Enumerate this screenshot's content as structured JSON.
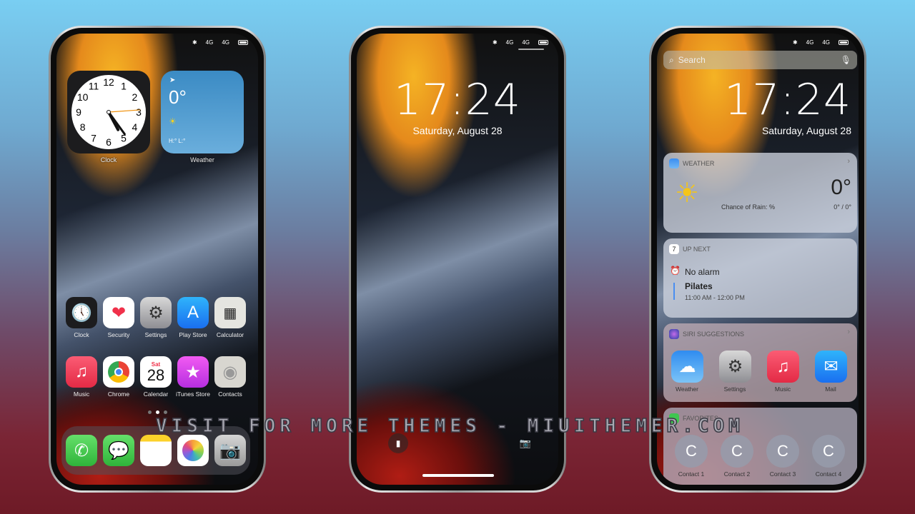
{
  "status_bar": {
    "bt": "✱",
    "sig1": "4G",
    "sig2": "4G"
  },
  "home": {
    "clock_widget": {
      "label": "Clock",
      "numbers": [
        "12",
        "1",
        "2",
        "3",
        "4",
        "5",
        "6",
        "7",
        "8",
        "9",
        "10",
        "11"
      ]
    },
    "weather_widget": {
      "temp": "0°",
      "hilo": "H:° L:°",
      "label": "Weather"
    },
    "apps": [
      {
        "label": "Clock",
        "icon": "clock"
      },
      {
        "label": "Security",
        "icon": "heart"
      },
      {
        "label": "Settings",
        "icon": "gear"
      },
      {
        "label": "Play Store",
        "icon": "appstore"
      },
      {
        "label": "Calculator",
        "icon": "calculator"
      },
      {
        "label": "Music",
        "icon": "music"
      },
      {
        "label": "Chrome",
        "icon": "chrome"
      },
      {
        "label": "Calendar",
        "icon": "calendar",
        "day": "Sat",
        "date": "28"
      },
      {
        "label": "iTunes Store",
        "icon": "star"
      },
      {
        "label": "Contacts",
        "icon": "contacts"
      }
    ],
    "page_dots": {
      "count": 3,
      "active": 2
    },
    "dock": [
      {
        "icon": "phone"
      },
      {
        "icon": "messages"
      },
      {
        "icon": "notes"
      },
      {
        "icon": "photos"
      },
      {
        "icon": "camera"
      }
    ]
  },
  "lock": {
    "time": "17:24",
    "date": "Saturday, August 28"
  },
  "today": {
    "search_placeholder": "Search",
    "time": "17:24",
    "date": "Saturday, August 28",
    "weather": {
      "title": "WEATHER",
      "temp": "0°",
      "rain": "Chance of Rain: %",
      "range": "0° / 0°"
    },
    "up_next": {
      "title": "UP NEXT",
      "cal_day": "7",
      "alarm": "No alarm",
      "event": "Pilates",
      "event_time": "11:00 AM - 12:00 PM"
    },
    "siri": {
      "title": "SIRI SUGGESTIONS",
      "apps": [
        {
          "label": "Weather",
          "icon": "weather"
        },
        {
          "label": "Settings",
          "icon": "gear"
        },
        {
          "label": "Music",
          "icon": "music"
        },
        {
          "label": "Mail",
          "icon": "mail"
        }
      ]
    },
    "favorites": {
      "title": "FAVORITES",
      "contacts": [
        {
          "initial": "C",
          "name": "Contact 1"
        },
        {
          "initial": "C",
          "name": "Contact 2"
        },
        {
          "initial": "C",
          "name": "Contact 3"
        },
        {
          "initial": "C",
          "name": "Contact 4"
        }
      ]
    }
  },
  "watermark": "VISIT FOR MORE THEMES - MIUITHEMER.COM"
}
